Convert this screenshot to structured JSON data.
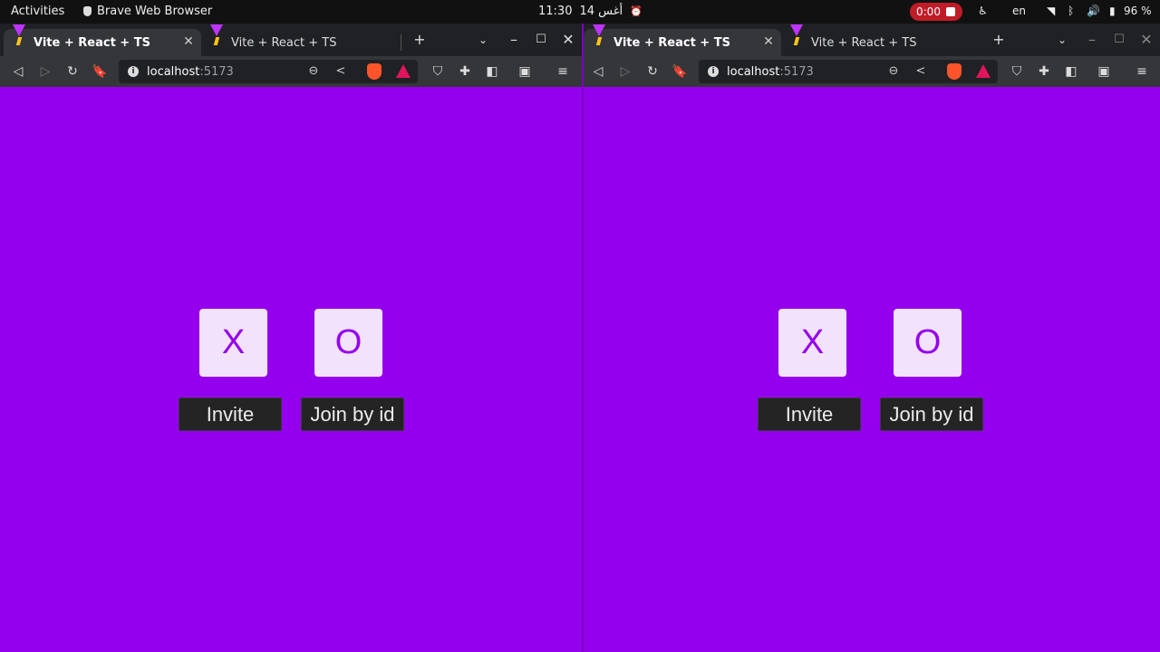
{
  "topbar": {
    "activities": "Activities",
    "app_name": "Brave Web Browser",
    "time": "11:30",
    "date": "14 أغس",
    "recording": "0:00",
    "language": "en",
    "battery": "96 %"
  },
  "browser": {
    "tabs": [
      {
        "title": "Vite + React + TS"
      },
      {
        "title": "Vite + React + TS"
      }
    ],
    "url_host": "localhost",
    "url_port": ":5173"
  },
  "game": {
    "x_label": "X",
    "o_label": "O",
    "invite_label": "Invite",
    "join_label": "Join by id"
  },
  "colors": {
    "page_background": "#9400ee",
    "tile_background": "#f2e2fb",
    "button_background": "#242424"
  }
}
